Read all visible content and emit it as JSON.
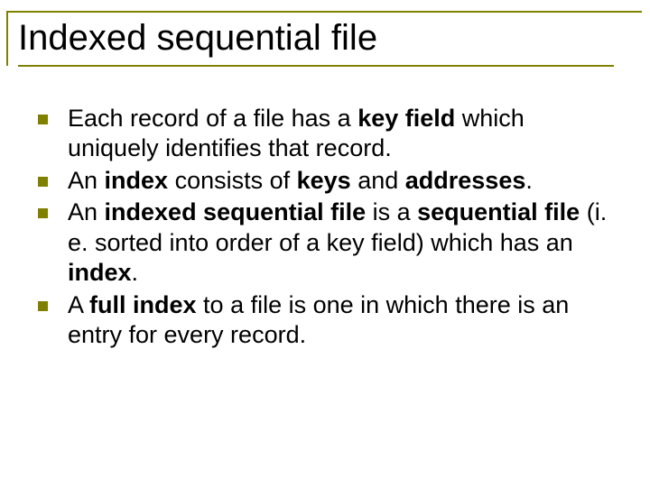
{
  "title": "Indexed sequential file",
  "bullets": [
    {
      "segments": [
        {
          "t": "Each record of a file has a ",
          "b": false
        },
        {
          "t": "key field",
          "b": true
        },
        {
          "t": " which uniquely identifies that record.",
          "b": false
        }
      ]
    },
    {
      "segments": [
        {
          "t": "An ",
          "b": false
        },
        {
          "t": "index",
          "b": true
        },
        {
          "t": " consists of ",
          "b": false
        },
        {
          "t": "keys",
          "b": true
        },
        {
          "t": " and ",
          "b": false
        },
        {
          "t": "addresses",
          "b": true
        },
        {
          "t": ".",
          "b": false
        }
      ]
    },
    {
      "segments": [
        {
          "t": "An ",
          "b": false
        },
        {
          "t": "indexed sequential file",
          "b": true
        },
        {
          "t": " is a ",
          "b": false
        },
        {
          "t": "sequential file",
          "b": true
        },
        {
          "t": " (i. e. sorted into order of a key field) which has an ",
          "b": false
        },
        {
          "t": "index",
          "b": true
        },
        {
          "t": ".",
          "b": false
        }
      ]
    },
    {
      "segments": [
        {
          "t": "A ",
          "b": false
        },
        {
          "t": "full index",
          "b": true
        },
        {
          "t": " to a file is one in which there is an entry for every record.",
          "b": false
        }
      ]
    }
  ]
}
